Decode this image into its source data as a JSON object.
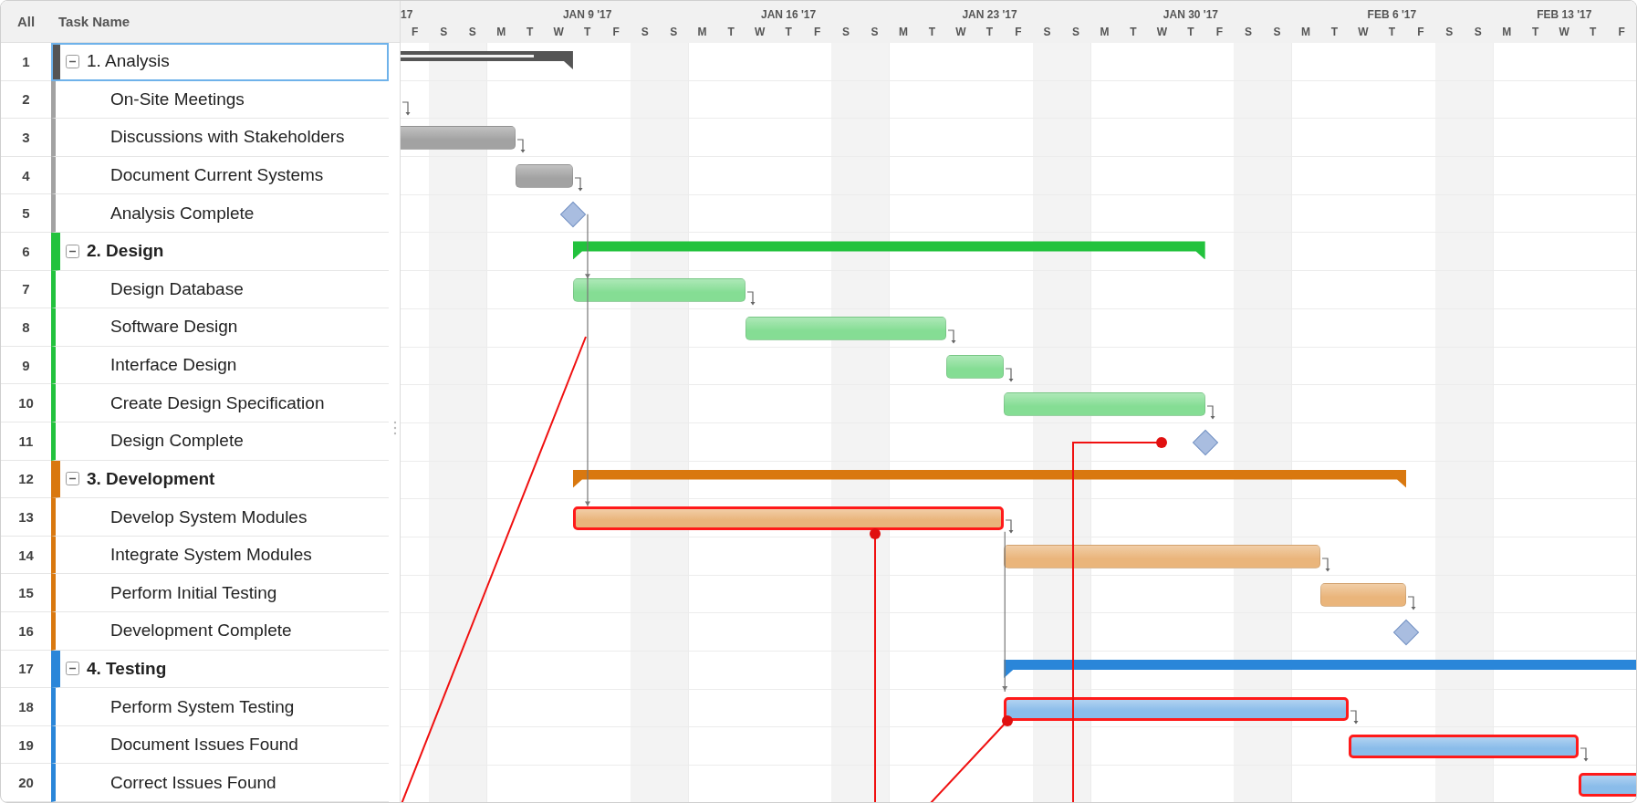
{
  "table": {
    "columns": [
      {
        "label": "All"
      },
      {
        "label": "Task Name"
      }
    ]
  },
  "timeline": {
    "days": [
      "F",
      "S",
      "S",
      "M",
      "T",
      "W",
      "T",
      "F",
      "S",
      "S",
      "M",
      "T",
      "W",
      "T",
      "F",
      "S",
      "S",
      "M",
      "T",
      "W",
      "T",
      "F",
      "S",
      "S",
      "M",
      "T",
      "W",
      "T",
      "F",
      "S",
      "S",
      "M",
      "T",
      "W",
      "T",
      "F",
      "S",
      "S",
      "M",
      "T",
      "W",
      "T",
      "F"
    ],
    "weeks": [
      {
        "label": "17"
      },
      {
        "label": "JAN 9 '17"
      },
      {
        "label": "JAN 16 '17"
      },
      {
        "label": "JAN 23 '17"
      },
      {
        "label": "JAN 30 '17"
      },
      {
        "label": "FEB 6 '17"
      },
      {
        "label": "FEB 13 '17"
      }
    ]
  },
  "groups": [
    {
      "number": "1",
      "name": "1. Analysis",
      "color": "#555555",
      "expanded": true,
      "selected": true,
      "level": 0.85,
      "children": [
        {
          "number": "2",
          "name": "On-Site Meetings",
          "kind": "task",
          "linked": true,
          "highlighted": false,
          "selected": false
        },
        {
          "number": "3",
          "name": "Discussions with Stakeholders",
          "kind": "task",
          "linked": true,
          "highlighted": false,
          "selected": false
        },
        {
          "number": "4",
          "name": "Document Current Systems",
          "kind": "task",
          "linked": true,
          "highlighted": false,
          "selected": false
        },
        {
          "number": "5",
          "name": "Analysis Complete",
          "kind": "milestone",
          "linked": false,
          "highlighted": false,
          "selected": false
        }
      ]
    },
    {
      "number": "6",
      "name": "2. Design",
      "color": "#22c23d",
      "expanded": true,
      "selected": false,
      "children": [
        {
          "number": "7",
          "name": "Design Database",
          "kind": "task",
          "linked": true,
          "highlighted": false,
          "selected": false
        },
        {
          "number": "8",
          "name": "Software Design",
          "kind": "task",
          "linked": true,
          "highlighted": false,
          "selected": false
        },
        {
          "number": "9",
          "name": "Interface Design",
          "kind": "task",
          "linked": true,
          "highlighted": false,
          "selected": false
        },
        {
          "number": "10",
          "name": "Create Design Specification",
          "kind": "task",
          "linked": true,
          "highlighted": false,
          "selected": false
        },
        {
          "number": "11",
          "name": "Design Complete",
          "kind": "milestone",
          "linked": false,
          "highlighted": false,
          "selected": false
        }
      ]
    },
    {
      "number": "12",
      "name": "3. Development",
      "color": "#d9780f",
      "expanded": true,
      "selected": false,
      "children": [
        {
          "number": "13",
          "name": "Develop System Modules",
          "kind": "task",
          "linked": true,
          "highlighted": true,
          "selected": false
        },
        {
          "number": "14",
          "name": "Integrate System Modules",
          "kind": "task",
          "linked": true,
          "highlighted": false,
          "selected": false
        },
        {
          "number": "15",
          "name": "Perform Initial Testing",
          "kind": "task",
          "linked": true,
          "highlighted": false,
          "selected": false
        },
        {
          "number": "16",
          "name": "Development Complete",
          "kind": "milestone",
          "linked": false,
          "highlighted": false,
          "selected": false
        }
      ]
    },
    {
      "number": "17",
      "name": "4. Testing",
      "color": "#2a86d9",
      "expanded": true,
      "selected": false,
      "children": [
        {
          "number": "18",
          "name": "Perform System Testing",
          "kind": "task",
          "linked": true,
          "highlighted": true,
          "selected": false
        },
        {
          "number": "19",
          "name": "Document Issues Found",
          "kind": "task",
          "linked": true,
          "highlighted": true,
          "selected": false
        },
        {
          "number": "20",
          "name": "Correct Issues Found",
          "kind": "task",
          "linked": false,
          "highlighted": true,
          "selected": false
        }
      ]
    }
  ]
}
